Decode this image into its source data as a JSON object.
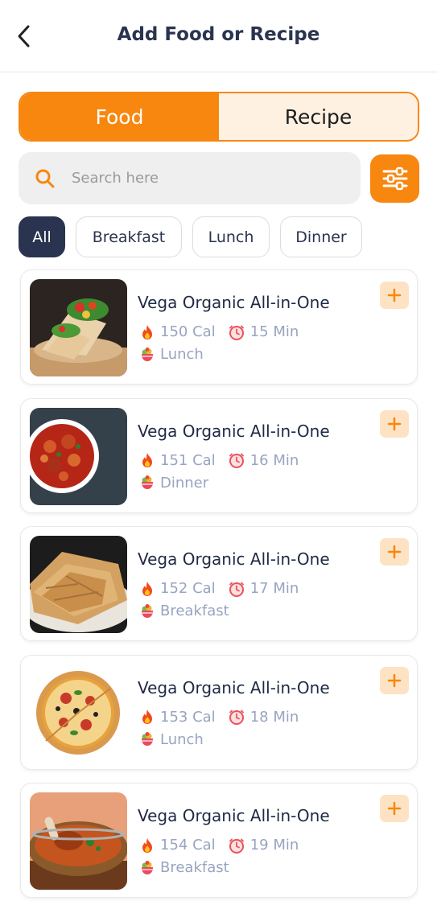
{
  "header": {
    "title": "Add Food or Recipe",
    "back_icon": "chevron-left-icon"
  },
  "tabs": [
    {
      "label": "Food",
      "active": true
    },
    {
      "label": "Recipe",
      "active": false
    }
  ],
  "search": {
    "placeholder": "Search here",
    "value": ""
  },
  "filters": [
    {
      "label": "All",
      "active": true
    },
    {
      "label": "Breakfast",
      "active": false
    },
    {
      "label": "Lunch",
      "active": false
    },
    {
      "label": "Dinner",
      "active": false
    }
  ],
  "items": [
    {
      "title": "Vega Organic All-in-One",
      "calories": "150 Cal",
      "time": "15 Min",
      "meal": "Lunch",
      "image": "wrap-photo"
    },
    {
      "title": "Vega Organic All-in-One",
      "calories": "151 Cal",
      "time": "16 Min",
      "meal": "Dinner",
      "image": "curry-bowl-photo"
    },
    {
      "title": "Vega Organic All-in-One",
      "calories": "152 Cal",
      "time": "17 Min",
      "meal": "Breakfast",
      "image": "crepes-photo"
    },
    {
      "title": "Vega Organic All-in-One",
      "calories": "153 Cal",
      "time": "18 Min",
      "meal": "Lunch",
      "image": "pizza-photo"
    },
    {
      "title": "Vega Organic All-in-One",
      "calories": "154 Cal",
      "time": "19 Min",
      "meal": "Breakfast",
      "image": "chicken-curry-photo"
    }
  ],
  "colors": {
    "accent": "#f7870f",
    "accent_light": "#fff1e2",
    "navy": "#2a3450",
    "muted": "#98a4c0"
  }
}
